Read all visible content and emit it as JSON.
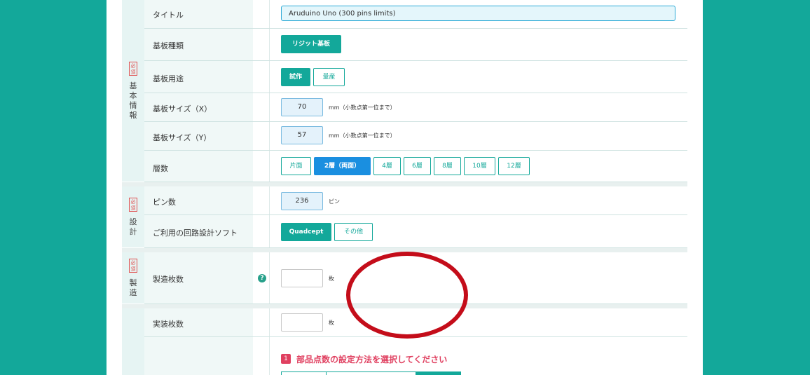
{
  "sections": [
    {
      "label": "基本情報",
      "required": "必須"
    },
    {
      "label": "設計",
      "required": "必須"
    },
    {
      "label": "製造",
      "required": "必須"
    }
  ],
  "basic": {
    "title_label": "タイトル",
    "title_value": "Aruduino Uno (300 pins limits)",
    "board_type_label": "基板種類",
    "board_type_option": "リジット基板",
    "usage_label": "基板用途",
    "usage_options": [
      "試作",
      "量産"
    ],
    "size_x_label": "基板サイズ（X）",
    "size_x_value": "70",
    "size_y_label": "基板サイズ（Y）",
    "size_y_value": "57",
    "size_unit": "mm（小数点第一位まで）",
    "layers_label": "層数",
    "layer_options": [
      "片面",
      "2層（両面）",
      "4層",
      "6層",
      "8層",
      "10層",
      "12層"
    ],
    "layer_selected": "2層（両面）"
  },
  "design": {
    "pins_label": "ピン数",
    "pins_value": "236",
    "pins_unit": "ピン",
    "software_label": "ご利用の回路設計ソフト",
    "software_options": [
      "Quadcept",
      "その他"
    ]
  },
  "manufacturing": {
    "quantity_label": "製造枚数",
    "quantity_value": "",
    "quantity_unit": "枚",
    "help": "?"
  },
  "assembly": {
    "quantity_label": "実装枚数",
    "quantity_value": "",
    "quantity_unit": "枚",
    "step_number": "1",
    "step_text": "部品点数の設定方法を選択してください"
  },
  "colors": {
    "background": "#13a89a",
    "accent": "#13a89a",
    "selected": "#1a8fe0",
    "required": "#e05050",
    "annotation": "#c40d1a"
  }
}
